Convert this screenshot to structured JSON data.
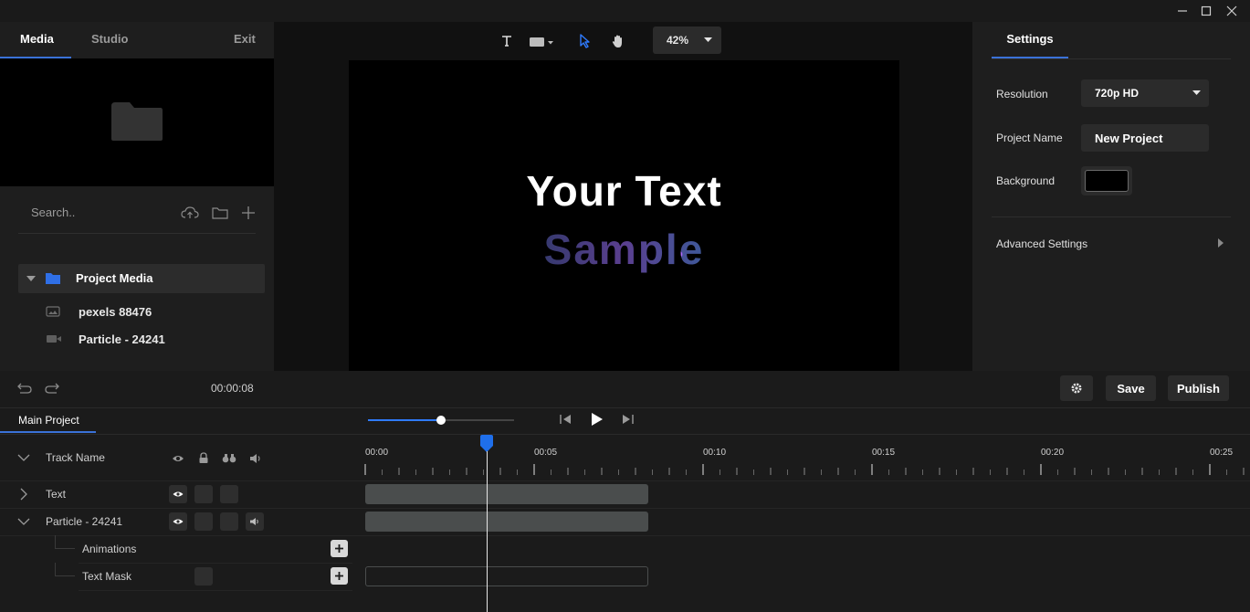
{
  "left_panel": {
    "tabs": {
      "media": "Media",
      "studio": "Studio",
      "exit": "Exit"
    },
    "search": {
      "placeholder": "Search.."
    },
    "project_media": "Project Media",
    "items": [
      "pexels 88476",
      "Particle - 24241"
    ]
  },
  "toolbar": {
    "zoom": "42%"
  },
  "canvas": {
    "line1": "Your Text",
    "line2": "Sample"
  },
  "settings": {
    "tab": "Settings",
    "resolution_label": "Resolution",
    "resolution_value": "720p HD",
    "project_name_label": "Project Name",
    "project_name_value": "New Project",
    "background_label": "Background",
    "background_color": "#000000",
    "advanced": "Advanced Settings"
  },
  "controls": {
    "time": "00:00:08",
    "save": "Save",
    "publish": "Publish",
    "progress": 0.5
  },
  "timeline": {
    "tab": "Main Project",
    "track_header": "Track Name",
    "tracks": [
      "Text",
      "Particle - 24241"
    ],
    "sub_tracks": [
      "Animations",
      "Text Mask"
    ],
    "ruler": [
      "00:00",
      "00:05",
      "00:10",
      "00:15",
      "00:20",
      "00:25"
    ],
    "playhead_seconds": 3.6
  },
  "colors": {
    "accent": "#3a72d8",
    "playhead": "#1f6feb"
  }
}
